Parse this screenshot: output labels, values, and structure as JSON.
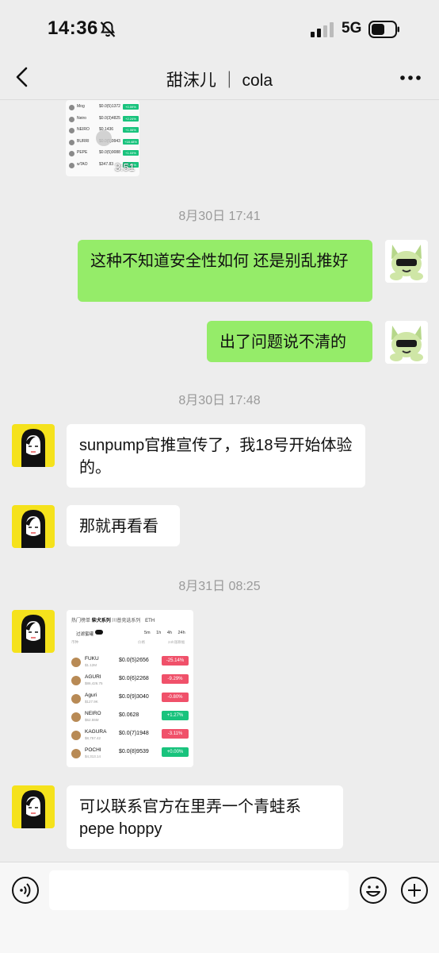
{
  "status_bar": {
    "time": "14:36",
    "network": "5G"
  },
  "header": {
    "title": "甜沫儿 ｜ cola"
  },
  "messages": {
    "ts1": "8月30日 17:41",
    "m1": "这种不知道安全性如何 还是别乱推好",
    "m2": "出了问题说不清的",
    "ts2": "8月30日 17:48",
    "m3": "sunpump官推宣传了，我18号开始体验的。",
    "m4": "那就再看看",
    "ts3": "8月31日 08:25",
    "m5": "可以联系官方在里弄一个青蛙系pepe hoppy"
  },
  "video_thumb": {
    "duration": "3:51",
    "rows": [
      {
        "ticker": "Mog",
        "price": "$0.0(5)1372",
        "change": "+0.59%"
      },
      {
        "ticker": "Neiro",
        "price": "$0.0(3)4825",
        "change": "+2.24%"
      },
      {
        "ticker": "NEIRO",
        "price": "$0.1436",
        "change": "+1.06%"
      },
      {
        "ticker": "BURRI",
        "price": "$0.0(5)9943",
        "change": "+18.48%"
      },
      {
        "ticker": "PEPE",
        "price": "$0.0(5)9088",
        "change": "+1.03%"
      },
      {
        "ticker": "wTAO",
        "price": "$347.83",
        "change": "+1.22%"
      }
    ]
  },
  "token_table": {
    "tabs": [
      "热门榜单",
      "柴犬系列",
      "川普竞选系列"
    ],
    "active_tab": "柴犬系列",
    "chain": "ETH",
    "filter_label": "过滤蜜罐",
    "periods": [
      "5m",
      "1h",
      "4h",
      "24h"
    ],
    "headers": [
      "币种",
      "价格",
      "24h涨跌幅"
    ],
    "rows": [
      {
        "name": "FUKU",
        "sub": "$1.12M",
        "price": "$0.0(5)2656",
        "change": "-25.14%",
        "color": "#f0516a"
      },
      {
        "name": "AGURI",
        "sub": "$86,426.75",
        "price": "$0.0(6)2268",
        "change": "-9.29%",
        "color": "#f0516a"
      },
      {
        "name": "Aguri",
        "sub": "$127.9K",
        "price": "$0.0(9)3040",
        "change": "-0.80%",
        "color": "#f0516a"
      },
      {
        "name": "NEIRO",
        "sub": "$62.55M",
        "price": "$0.0628",
        "change": "+1.27%",
        "color": "#19c37d"
      },
      {
        "name": "KAGURA",
        "sub": "$8,757.42",
        "price": "$0.0(7)1948",
        "change": "-3.11%",
        "color": "#f0516a"
      },
      {
        "name": "POCHI",
        "sub": "$4,313.14",
        "price": "$0.0(8)9539",
        "change": "+0.00%",
        "color": "#19c37d"
      }
    ]
  },
  "input": {
    "placeholder": ""
  },
  "colors": {
    "own_bubble": "#95ec69",
    "other_bubble": "#ffffff",
    "background": "#ededed"
  }
}
